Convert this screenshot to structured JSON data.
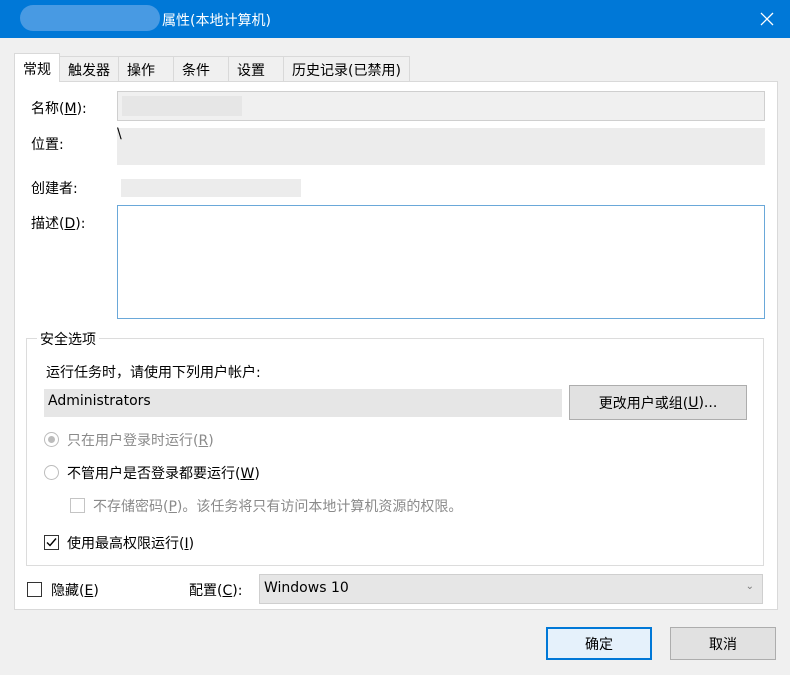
{
  "window": {
    "title": "属性(本地计算机)"
  },
  "tabs": [
    {
      "label": "常规",
      "active": true
    },
    {
      "label": "触发器"
    },
    {
      "label": "操作"
    },
    {
      "label": "条件"
    },
    {
      "label": "设置"
    },
    {
      "label": "历史记录(已禁用)"
    }
  ],
  "general": {
    "name_label_pre": "名称(",
    "name_label_key": "M",
    "name_label_post": "):",
    "location_label": "位置:",
    "location_value": "\\",
    "author_label": "创建者:",
    "desc_label_pre": "描述(",
    "desc_label_key": "D",
    "desc_label_post": "):",
    "description": ""
  },
  "security": {
    "title": "安全选项",
    "prompt": "运行任务时，请使用下列用户帐户:",
    "account": "Administrators",
    "change_btn_pre": "更改用户或组(",
    "change_btn_key": "U",
    "change_btn_post": ")...",
    "radio1_pre": "只在用户登录时运行(",
    "radio1_key": "R",
    "radio1_post": ")",
    "radio2_pre": "不管用户是否登录都要运行(",
    "radio2_key": "W",
    "radio2_post": ")",
    "nostore_pre": "不存储密码(",
    "nostore_key": "P",
    "nostore_post": ")。该任务将只有访问本地计算机资源的权限。",
    "highest_pre": "使用最高权限运行(",
    "highest_key": "I",
    "highest_post": ")",
    "highest_checked": true
  },
  "footer": {
    "hidden_pre": "隐藏(",
    "hidden_key": "E",
    "hidden_post": ")",
    "config_pre": "配置(",
    "config_key": "C",
    "config_post": "):",
    "config_value": "Windows 10",
    "ok": "确定",
    "cancel": "取消"
  },
  "icons": {
    "close": "close-icon",
    "dropdown": "chevron-down-icon",
    "check": "checkmark-icon"
  }
}
